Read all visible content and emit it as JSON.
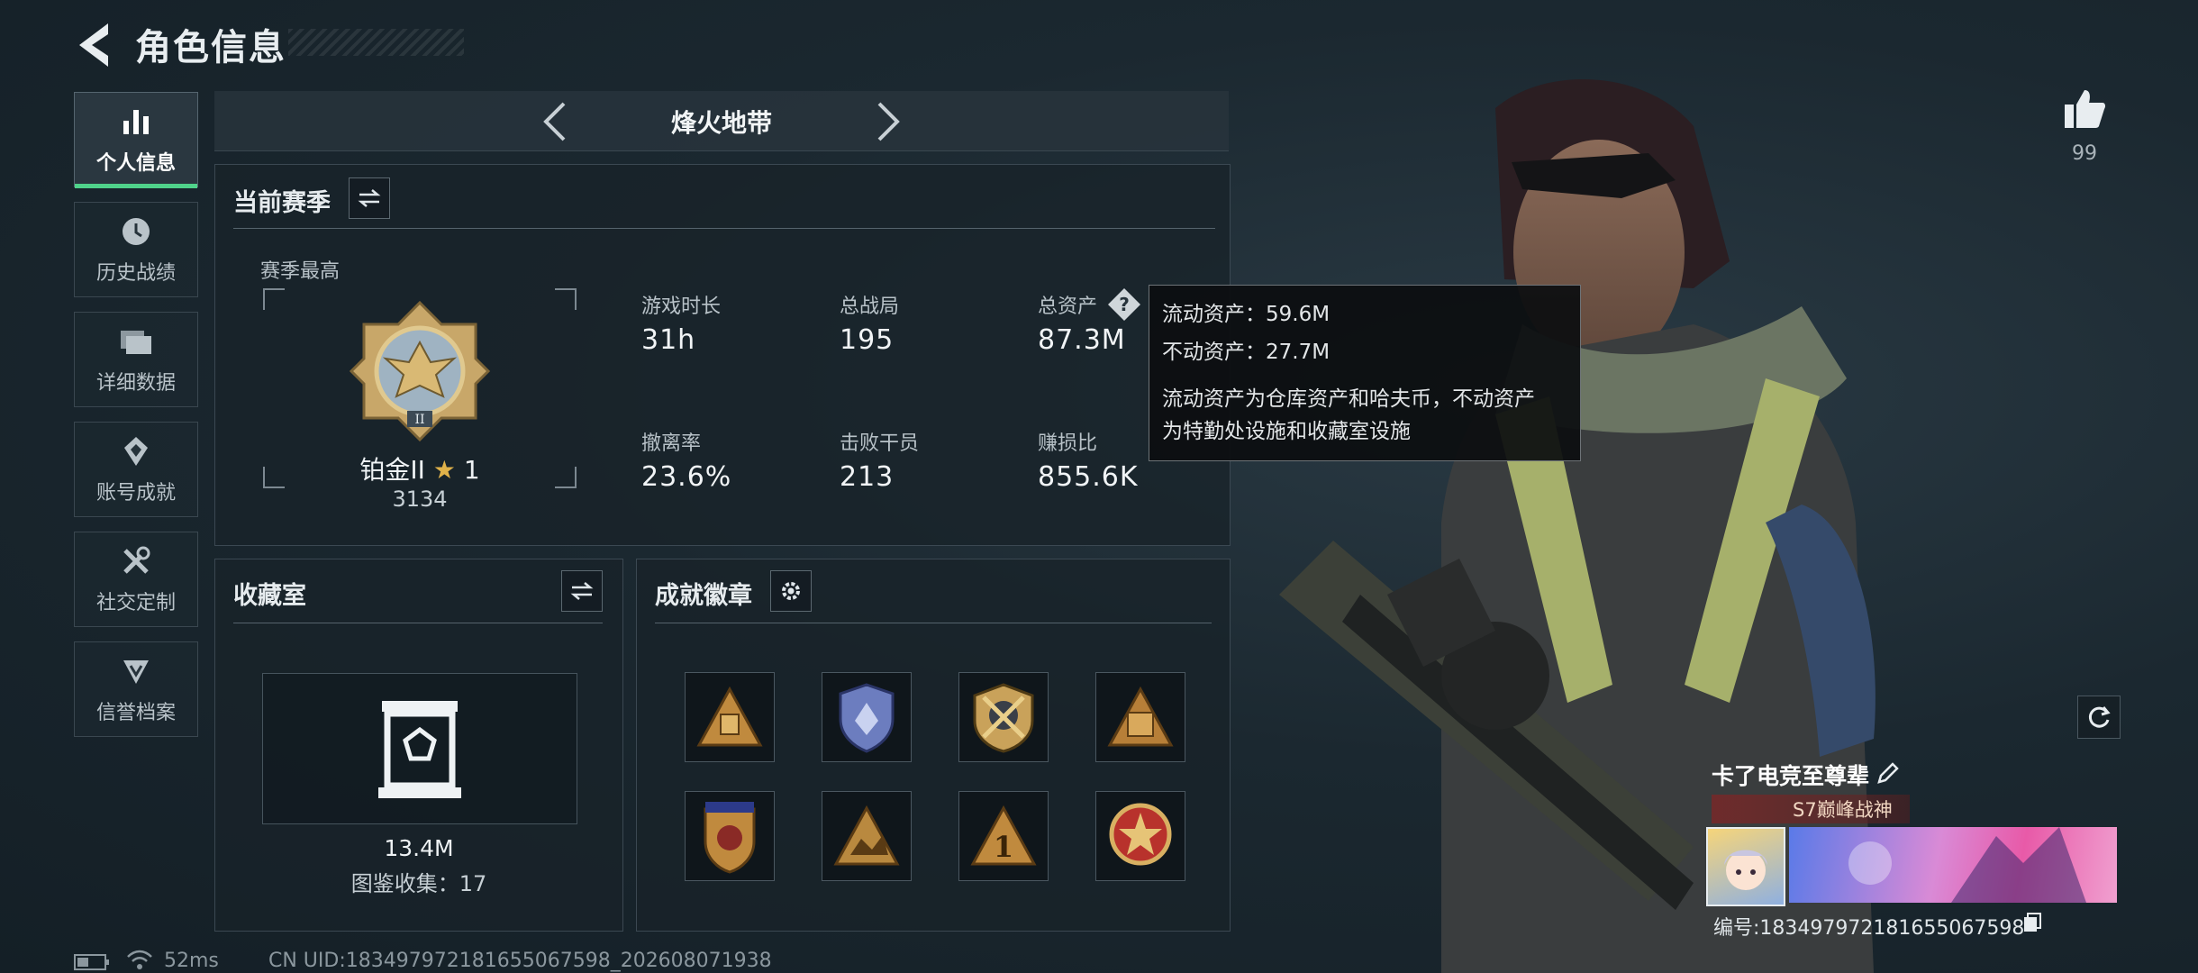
{
  "header": {
    "title": "角色信息"
  },
  "sidebar": {
    "items": [
      {
        "label": "个人信息",
        "icon": "bar-chart-icon",
        "active": true
      },
      {
        "label": "历史战绩",
        "icon": "history-icon"
      },
      {
        "label": "详细数据",
        "icon": "folder-icon"
      },
      {
        "label": "账号成就",
        "icon": "achievement-icon"
      },
      {
        "label": "社交定制",
        "icon": "tools-icon"
      },
      {
        "label": "信誉档案",
        "icon": "credit-icon"
      }
    ]
  },
  "mode": {
    "name": "烽火地带"
  },
  "season": {
    "title": "当前赛季",
    "best_label": "赛季最高",
    "rank_name": "铂金II",
    "rank_stars": "1",
    "rank_points": "3134",
    "stats": [
      {
        "label": "游戏时长",
        "value": "31h"
      },
      {
        "label": "总战局",
        "value": "195"
      },
      {
        "label": "总资产",
        "value": "87.3M"
      },
      {
        "label": "撤离率",
        "value": "23.6%"
      },
      {
        "label": "击败干员",
        "value": "213"
      },
      {
        "label": "赚损比",
        "value": "855.6K"
      }
    ]
  },
  "tooltip": {
    "liquid": "流动资产：59.6M",
    "fixed": "不动资产：27.7M",
    "desc_line1": "流动资产为仓库资产和哈夫币，不动资产",
    "desc_line2": "为特勤处设施和收藏室设施"
  },
  "collection": {
    "title": "收藏室",
    "value": "13.4M",
    "catalog": "图鉴收集：17"
  },
  "badges": {
    "title": "成就徽章",
    "items": [
      "badge-1",
      "badge-2",
      "badge-3",
      "badge-4",
      "badge-5",
      "badge-6",
      "badge-7",
      "badge-8"
    ]
  },
  "profile": {
    "likes": "99",
    "name": "卡了电竞至尊辈",
    "title_tag": "S7巅峰战神",
    "id_text": "编号:183497972181655067598"
  },
  "status": {
    "ping": "52ms",
    "uid": "CN UID:183497972181655067598_202608071938"
  },
  "colors": {
    "accent": "#4fd38b",
    "gold": "#c9a25a"
  }
}
